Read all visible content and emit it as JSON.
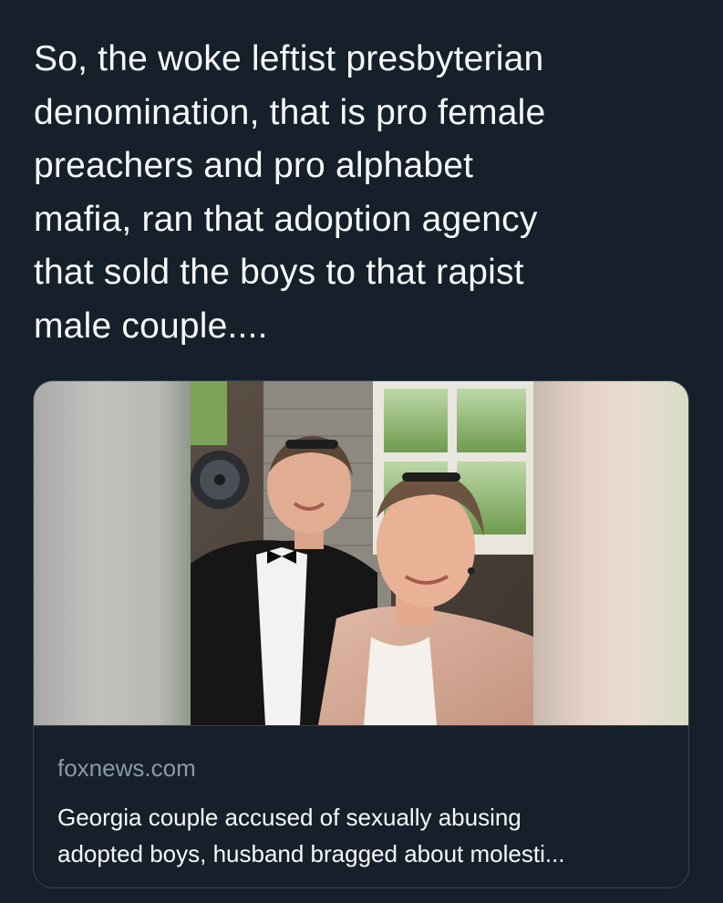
{
  "tweet": {
    "text_lines": [
      "So, the woke leftist presbyterian",
      "denomination, that is pro female",
      "preachers and pro alphabet",
      "mafia, ran that adoption agency",
      "that sold the boys to that rapist",
      "male couple...."
    ]
  },
  "card": {
    "domain": "foxnews.com",
    "headline_lines": [
      "Georgia couple accused of sexually abusing",
      "adopted boys, husband bragged about molesti..."
    ],
    "image_description_icon": "photo-of-two-men-selfie"
  },
  "colors": {
    "background": "#15202b",
    "text_primary": "#f7f9f9",
    "text_secondary": "#8b98a5",
    "border": "#38444d"
  }
}
